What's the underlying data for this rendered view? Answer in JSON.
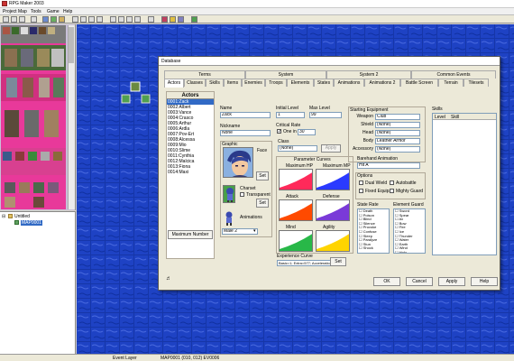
{
  "window": {
    "title": "RPG Maker 2003"
  },
  "menu": [
    "Project",
    "Map",
    "Tools",
    "Game",
    "Help"
  ],
  "map_tree": {
    "root": "Untitled",
    "map": "MAP0001"
  },
  "status": {
    "layer": "Event Layer",
    "position": "MAP0001 (010, 012) EV0006"
  },
  "dialog": {
    "title": "Database",
    "tabs_top": [
      "Terms",
      "System",
      "System 2",
      "Common Events"
    ],
    "tabs_bottom": [
      "Actors",
      "Classes",
      "Skills",
      "Items",
      "Enemies",
      "Troops",
      "Elements",
      "States",
      "Animations",
      "Animations 2",
      "Battle Screen",
      "Terrain",
      "Tilesets"
    ],
    "actors_header": "Actors",
    "actors": [
      "0001:Zack",
      "0002:Albert",
      "0003:Vance",
      "0004:Crasco",
      "0005:Arthur",
      "0006:Ardla",
      "0007:Pov-Ert",
      "0008:Alcessa",
      "0009:Mio",
      "0010:Slime",
      "0011:Cynthia",
      "0012:Malcica",
      "0013:Fiona",
      "0014:Maxi"
    ],
    "max_number_button": "Maximum Number",
    "name_label": "Name",
    "name_value": "Zack",
    "nickname_label": "Nickname",
    "nickname_value": "None",
    "initial_level_label": "Initial Level",
    "initial_level_value": "1",
    "max_level_label": "Max Level",
    "max_level_value": "99",
    "critical_rate_label": "Critical Rate",
    "critical_rate_check": "One in",
    "critical_rate_value": "30",
    "graphic_label": "Graphic",
    "face_label": "Face",
    "set_label": "Set",
    "charset_label": "Charset",
    "transparent_label": "Transparent",
    "animations_label": "Animations",
    "animation_value": "Male 2",
    "class_label": "Class",
    "class_value": "(None)",
    "apply_label": "Apply",
    "param_curves_label": "Parameter Curves",
    "curves": [
      {
        "title": "Maximum HP",
        "value": "Now:574",
        "color": "#ff2a5a"
      },
      {
        "title": "Maximum MP",
        "value": "Now:43",
        "color": "#2a3aff"
      },
      {
        "title": "Attack",
        "value": "Now:69",
        "color": "#ff4a00"
      },
      {
        "title": "Defense",
        "value": "Now:67",
        "color": "#7a3ad8"
      },
      {
        "title": "Mind",
        "value": "Now:53",
        "color": "#28b848"
      },
      {
        "title": "Agility",
        "value": "Now:59",
        "color": "#ffd400"
      }
    ],
    "exp_curve_label": "Experience Curve",
    "exp_curve_value": "Basic=1; Extra=577; Acceleration=40",
    "starting_equipment_label": "Starting Equipment",
    "equipment": [
      {
        "slot": "Weapon",
        "value": "Club"
      },
      {
        "slot": "Shield",
        "value": "(None)"
      },
      {
        "slot": "Head",
        "value": "(None)"
      },
      {
        "slot": "Body",
        "value": "Leather Armor"
      },
      {
        "slot": "Accessory",
        "value": "(None)"
      }
    ],
    "barehand_label": "Barehand Animation",
    "barehand_value": "Hit A",
    "options_label": "Options",
    "options": [
      "Dual Wield",
      "Autobattle",
      "Fixed Equip.",
      "Mighty Guard"
    ],
    "skills_label": "Skills",
    "skills_cols": [
      "Level",
      "Skill"
    ],
    "state_rate_label": "State Rate",
    "states": [
      "Death",
      "Poison",
      "Blind",
      "Silence",
      "Provoke",
      "Confuse",
      "Sleep",
      "Paralyze",
      "Stun",
      "Shock"
    ],
    "element_guard_label": "Element Guard",
    "elements": [
      "Sword",
      "Spear",
      "Ax",
      "Bow",
      "Fire",
      "Ice",
      "Thunder",
      "Water",
      "Earth",
      "Wind",
      "Holy"
    ],
    "buttons": {
      "ok": "OK",
      "cancel": "Cancel",
      "apply": "Apply",
      "help": "Help"
    }
  }
}
